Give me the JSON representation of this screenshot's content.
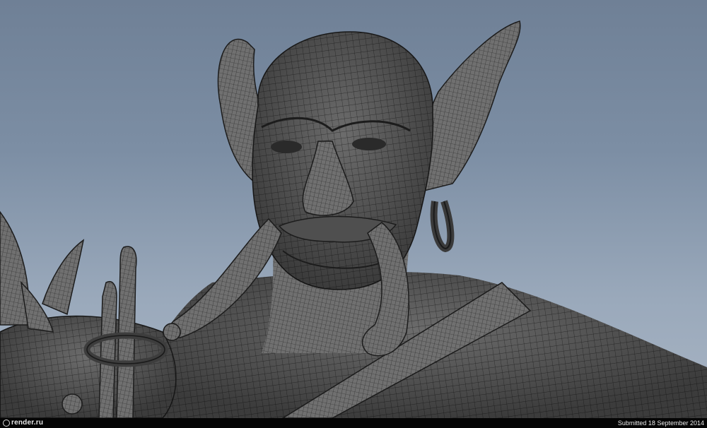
{
  "image": {
    "subject": "wireframe-shaded-goblin-3d-model",
    "background_gradient": [
      "#6f8096",
      "#a9b5c4"
    ],
    "mesh_fill": "#6c6c6c",
    "mesh_line": "#1c1c1c"
  },
  "footer": {
    "logo_text": "render.ru",
    "submitted_text": "Submitted 18 September 2014"
  }
}
